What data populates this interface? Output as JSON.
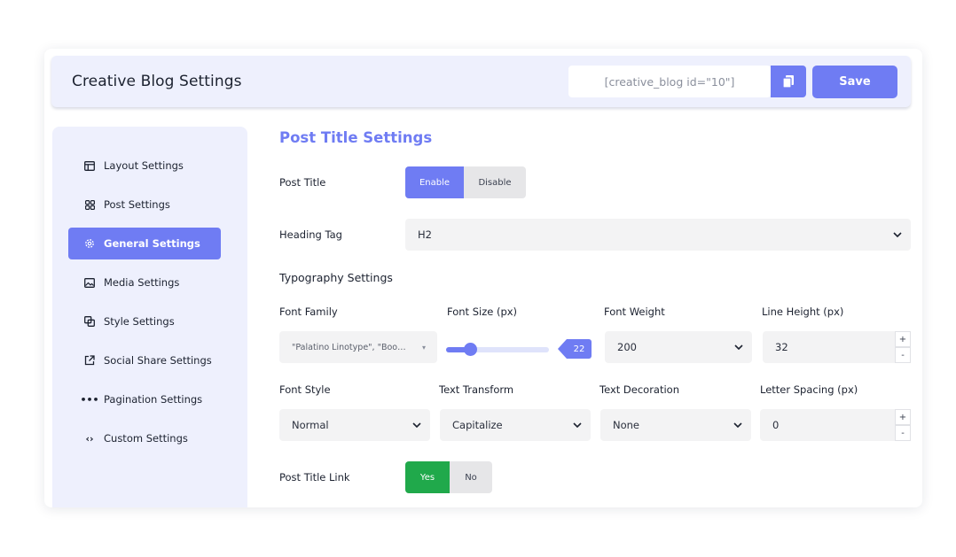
{
  "header": {
    "title": "Creative Blog Settings",
    "shortcode": "[creative_blog id=\"10\"]",
    "save_label": "Save"
  },
  "sidebar": {
    "items": [
      {
        "label": "Layout Settings",
        "icon": "layout-icon"
      },
      {
        "label": "Post Settings",
        "icon": "grid-icon"
      },
      {
        "label": "General Settings",
        "icon": "gear-icon",
        "active": true
      },
      {
        "label": "Media Settings",
        "icon": "image-icon"
      },
      {
        "label": "Style Settings",
        "icon": "copy-style-icon"
      },
      {
        "label": "Social Share Settings",
        "icon": "share-link-icon"
      },
      {
        "label": "Pagination Settings",
        "icon": "ellipsis-icon"
      },
      {
        "label": "Custom Settings",
        "icon": "code-icon"
      }
    ]
  },
  "main": {
    "section_title": "Post Title Settings",
    "post_title": {
      "label": "Post Title",
      "options": [
        "Enable",
        "Disable"
      ],
      "selected": "Enable"
    },
    "heading_tag": {
      "label": "Heading Tag",
      "value": "H2"
    },
    "typography_title": "Typography Settings",
    "font_family": {
      "label": "Font Family",
      "value": "\"Palatino Linotype\", \"Book A..."
    },
    "font_size": {
      "label": "Font Size (px)",
      "value": "22"
    },
    "font_weight": {
      "label": "Font Weight",
      "value": "200"
    },
    "line_height": {
      "label": "Line Height (px)",
      "value": "32"
    },
    "font_style": {
      "label": "Font Style",
      "value": "Normal"
    },
    "text_transform": {
      "label": "Text Transform",
      "value": "Capitalize"
    },
    "text_decoration": {
      "label": "Text Decoration",
      "value": "None"
    },
    "letter_spacing": {
      "label": "Letter Spacing (px)",
      "value": "0"
    },
    "post_title_link": {
      "label": "Post Title Link",
      "options": [
        "Yes",
        "No"
      ],
      "selected": "Yes"
    },
    "stepper_plus": "+",
    "stepper_minus": "-"
  },
  "colors": {
    "accent": "#6f7cf3",
    "success": "#20a94b",
    "panel": "#eef0fd"
  }
}
